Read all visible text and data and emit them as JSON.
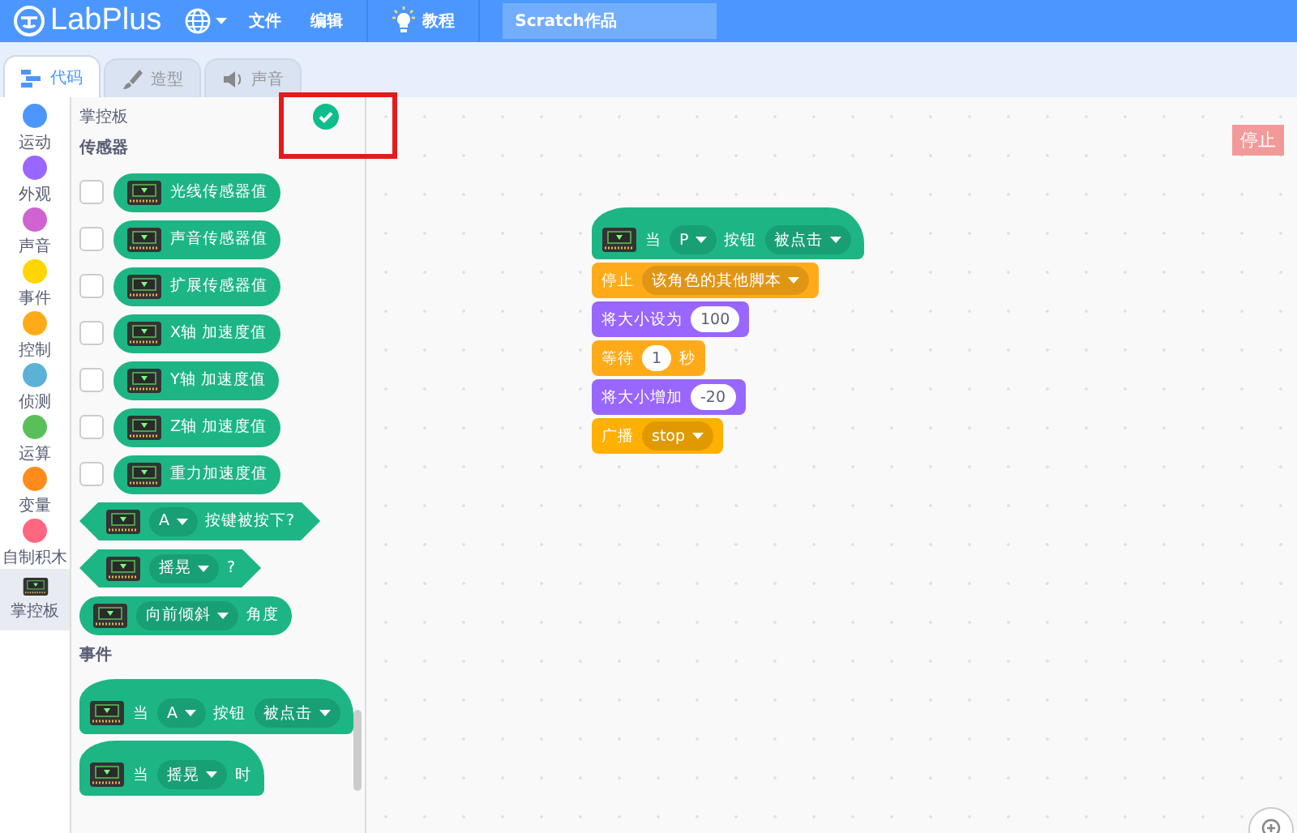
{
  "menu_bar": {
    "logo": "LabPlus",
    "items": [
      "文件",
      "编辑"
    ],
    "tutorial": "教程",
    "project_title": "Scratch作品"
  },
  "tabs": [
    {
      "label": "代码",
      "kind": "code",
      "selected": true
    },
    {
      "label": "造型",
      "kind": "costume",
      "selected": false
    },
    {
      "label": "声音",
      "kind": "sound",
      "selected": false
    }
  ],
  "categories": [
    {
      "label": "运动",
      "kind": "dot",
      "color": "#4c97ff",
      "selected": false
    },
    {
      "label": "外观",
      "kind": "dot",
      "color": "#9966ff",
      "selected": false
    },
    {
      "label": "声音",
      "kind": "dot",
      "color": "#cf63cf",
      "selected": false
    },
    {
      "label": "事件",
      "kind": "dot",
      "color": "#ffd500",
      "selected": false
    },
    {
      "label": "控制",
      "kind": "dot",
      "color": "#ffab19",
      "selected": false
    },
    {
      "label": "侦测",
      "kind": "dot",
      "color": "#5cb1d6",
      "selected": false
    },
    {
      "label": "运算",
      "kind": "dot",
      "color": "#59c059",
      "selected": false
    },
    {
      "label": "变量",
      "kind": "dot",
      "color": "#ff8c1a",
      "selected": false
    },
    {
      "label": "自制积木",
      "kind": "dot",
      "color": "#ff6680",
      "selected": false
    },
    {
      "label": "掌控板",
      "kind": "board",
      "selected": true
    }
  ],
  "palette": {
    "extension_title": "掌控板",
    "connected": true,
    "sections": [
      {
        "title": "传感器",
        "blocks": [
          {
            "kind": "reporter",
            "icon": true,
            "checked": false,
            "parts": [
              {
                "kind": "text",
                "text": "光线传感器值"
              }
            ]
          },
          {
            "kind": "reporter",
            "icon": true,
            "checked": false,
            "parts": [
              {
                "kind": "text",
                "text": "声音传感器值"
              }
            ]
          },
          {
            "kind": "reporter",
            "icon": true,
            "checked": false,
            "parts": [
              {
                "kind": "text",
                "text": "扩展传感器值"
              }
            ]
          },
          {
            "kind": "reporter",
            "icon": true,
            "checked": false,
            "parts": [
              {
                "kind": "text",
                "text": "X轴 加速度值"
              }
            ]
          },
          {
            "kind": "reporter",
            "icon": true,
            "checked": false,
            "parts": [
              {
                "kind": "text",
                "text": "Y轴 加速度值"
              }
            ]
          },
          {
            "kind": "reporter",
            "icon": true,
            "checked": false,
            "parts": [
              {
                "kind": "text",
                "text": "Z轴 加速度值"
              }
            ]
          },
          {
            "kind": "reporter",
            "icon": true,
            "checked": false,
            "parts": [
              {
                "kind": "text",
                "text": "重力加速度值"
              }
            ]
          },
          {
            "kind": "boolean",
            "icon": true,
            "parts": [
              {
                "kind": "dropdown",
                "text": "A"
              },
              {
                "kind": "text",
                "text": "按键被按下?"
              }
            ]
          },
          {
            "kind": "boolean",
            "icon": true,
            "parts": [
              {
                "kind": "dropdown",
                "text": "摇晃"
              },
              {
                "kind": "text",
                "text": "?"
              }
            ]
          },
          {
            "kind": "reporter",
            "icon": true,
            "parts": [
              {
                "kind": "dropdown",
                "text": "向前倾斜"
              },
              {
                "kind": "text",
                "text": "角度"
              }
            ]
          }
        ]
      },
      {
        "title": "事件",
        "blocks": [
          {
            "kind": "hat",
            "icon": true,
            "parts": [
              {
                "kind": "text",
                "text": "当"
              },
              {
                "kind": "dropdown",
                "text": "A"
              },
              {
                "kind": "text",
                "text": "按钮"
              },
              {
                "kind": "dropdown",
                "text": "被点击"
              }
            ]
          },
          {
            "kind": "hat",
            "icon": true,
            "parts": [
              {
                "kind": "text",
                "text": "当"
              },
              {
                "kind": "dropdown",
                "text": "摇晃"
              },
              {
                "kind": "text",
                "text": "时"
              }
            ]
          }
        ]
      }
    ]
  },
  "canvas": {
    "stop_button": "停止",
    "script": [
      {
        "kind": "hat",
        "icon": true,
        "color": "#1db584",
        "parts": [
          {
            "kind": "text",
            "text": "当"
          },
          {
            "kind": "dropdown",
            "text": "P"
          },
          {
            "kind": "text",
            "text": "按钮"
          },
          {
            "kind": "dropdown",
            "text": "被点击"
          }
        ]
      },
      {
        "kind": "command",
        "icon": false,
        "color": "#ffab19",
        "parts": [
          {
            "kind": "text",
            "text": "停止"
          },
          {
            "kind": "dropdown",
            "text": "该角色的其他脚本"
          }
        ]
      },
      {
        "kind": "command",
        "icon": false,
        "color": "#9966ff",
        "parts": [
          {
            "kind": "text",
            "text": "将大小设为"
          },
          {
            "kind": "input",
            "text": "100"
          }
        ]
      },
      {
        "kind": "command",
        "icon": false,
        "color": "#ffab19",
        "parts": [
          {
            "kind": "text",
            "text": "等待"
          },
          {
            "kind": "input",
            "text": "1"
          },
          {
            "kind": "text",
            "text": "秒"
          }
        ]
      },
      {
        "kind": "command",
        "icon": false,
        "color": "#9966ff",
        "parts": [
          {
            "kind": "text",
            "text": "将大小增加"
          },
          {
            "kind": "input",
            "text": "-20"
          }
        ]
      },
      {
        "kind": "command",
        "icon": false,
        "color": "#ffb000",
        "parts": [
          {
            "kind": "text",
            "text": "广播"
          },
          {
            "kind": "dropdown",
            "text": "stop"
          }
        ]
      }
    ]
  }
}
